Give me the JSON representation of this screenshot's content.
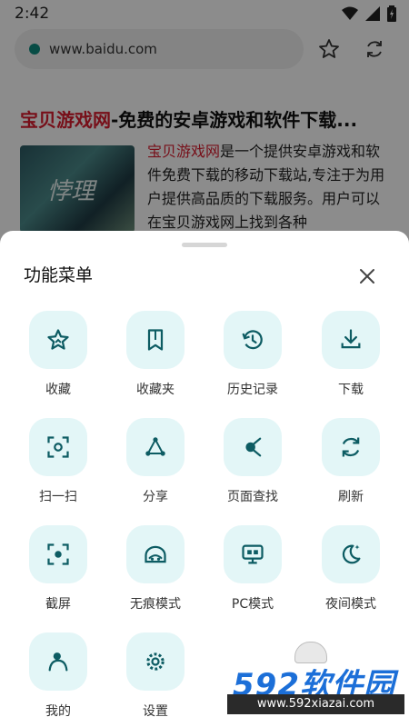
{
  "status_bar": {
    "time": "2:42"
  },
  "browser": {
    "url": "www.baidu.com"
  },
  "page": {
    "title_brand": "宝贝游戏网",
    "title_rest": "-免费的安卓游戏和软件下载...",
    "thumb_text": "悖理",
    "desc_brand": "宝贝游戏网",
    "desc_rest": "是一个提供安卓游戏和软件免费下载的移动下载站,专注于为用户提供高品质的下载服务。用户可以在宝贝游戏网上找到各种"
  },
  "menu": {
    "title": "功能菜单",
    "items": [
      {
        "label": "收藏",
        "icon": "star-icon"
      },
      {
        "label": "收藏夹",
        "icon": "bookmark-icon"
      },
      {
        "label": "历史记录",
        "icon": "history-icon"
      },
      {
        "label": "下载",
        "icon": "download-icon"
      },
      {
        "label": "扫一扫",
        "icon": "scan-icon"
      },
      {
        "label": "分享",
        "icon": "share-icon"
      },
      {
        "label": "页面查找",
        "icon": "page-find-icon"
      },
      {
        "label": "刷新",
        "icon": "refresh-icon"
      },
      {
        "label": "截屏",
        "icon": "screenshot-icon"
      },
      {
        "label": "无痕模式",
        "icon": "incognito-icon"
      },
      {
        "label": "PC模式",
        "icon": "pc-mode-icon"
      },
      {
        "label": "夜间模式",
        "icon": "night-mode-icon"
      },
      {
        "label": "我的",
        "icon": "profile-icon"
      },
      {
        "label": "设置",
        "icon": "settings-icon"
      }
    ]
  },
  "watermark": {
    "brand": "592软件园",
    "site": "www.592xiazai.com"
  },
  "colors": {
    "accent": "#0d5c63",
    "icon_bg": "#e3f6f7",
    "brand_red": "#d91c2e"
  }
}
